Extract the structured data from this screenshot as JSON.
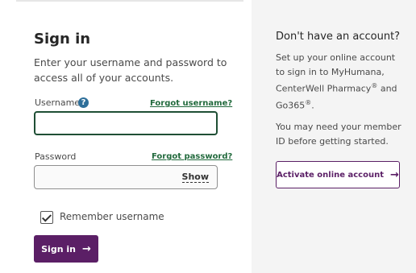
{
  "signin": {
    "title": "Sign in",
    "intro": "Enter your username and password to access all of your accounts.",
    "username_label": "Username",
    "forgot_username": "Forgot username?",
    "username_value": "",
    "password_label": "Password",
    "forgot_password": "Forgot password?",
    "password_value": "",
    "show_label": "Show",
    "remember_label": "Remember username",
    "remember_checked": true,
    "button_label": "Sign in"
  },
  "register": {
    "title": "Don't have an account?",
    "text1_prefix": "Set up your online account to sign in to MyHumana, CenterWell Pharmacy",
    "text1_mid": " and Go365",
    "text1_suffix": ".",
    "text2": "You may need your member ID before getting started.",
    "button_label": "Activate online account"
  },
  "icons": {
    "help": "question-circle-icon",
    "arrow": "arrow-right-icon",
    "check": "checkmark-icon"
  },
  "colors": {
    "brand_purple": "#5b1f66",
    "link_green": "#226a3d",
    "focus_border": "#1f4f35",
    "panel_bg": "#f4f4f4"
  }
}
